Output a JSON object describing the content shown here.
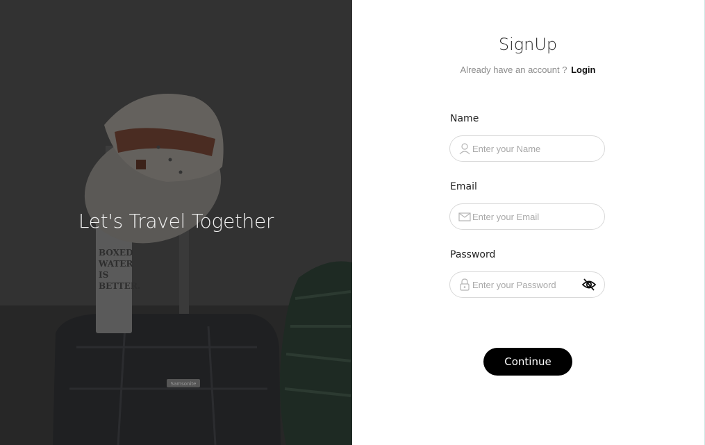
{
  "hero": {
    "title": "Let's Travel Together",
    "bottle_text": [
      "BOXED",
      "WATER",
      "IS",
      "BETTER."
    ],
    "suitcase_brand": "Samsonite"
  },
  "form": {
    "title": "SignUp",
    "account_prompt": "Already have an account ?",
    "login_label": "Login",
    "name": {
      "label": "Name",
      "placeholder": "Enter your Name",
      "icon": "user-icon"
    },
    "email": {
      "label": "Email",
      "placeholder": "Enter your Email",
      "icon": "envelope-icon"
    },
    "password": {
      "label": "Password",
      "placeholder": "Enter your Password",
      "icon": "lock-icon",
      "toggle_icon": "eye-slash-icon"
    },
    "continue_label": "Continue"
  },
  "colors": {
    "accent": "#000000",
    "hero_overlay": "#2c2c2c",
    "input_border": "#d9d9d9",
    "placeholder": "#a8a8a8"
  }
}
